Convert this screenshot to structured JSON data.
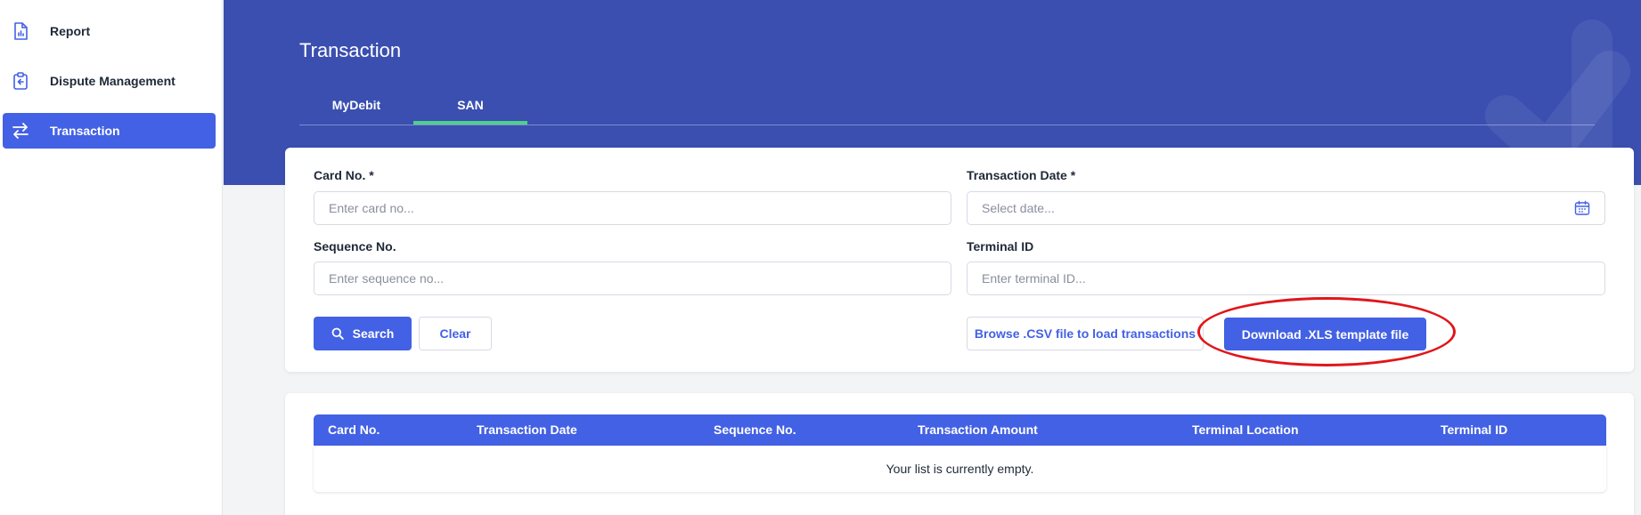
{
  "sidebar": {
    "items": [
      {
        "label": "Report",
        "icon": "report-icon"
      },
      {
        "label": "Dispute Management",
        "icon": "clipboard-icon"
      },
      {
        "label": "Transaction",
        "icon": "swap-arrows-icon",
        "active": true
      }
    ]
  },
  "header": {
    "title": "Transaction",
    "tabs": [
      {
        "label": "MyDebit",
        "active": false
      },
      {
        "label": "SAN",
        "active": true
      }
    ]
  },
  "form": {
    "card_no": {
      "label": "Card No. *",
      "placeholder": "Enter card no...",
      "value": ""
    },
    "transaction_date": {
      "label": "Transaction Date *",
      "placeholder": "Select date...",
      "value": "",
      "icon": "calendar-icon"
    },
    "sequence_no": {
      "label": "Sequence No.",
      "placeholder": "Enter sequence no...",
      "value": ""
    },
    "terminal_id": {
      "label": "Terminal ID",
      "placeholder": "Enter terminal ID...",
      "value": ""
    },
    "buttons": {
      "search": "Search",
      "clear": "Clear",
      "browse_csv": "Browse .CSV file to load transactions",
      "download_xls": "Download .XLS template file"
    }
  },
  "table": {
    "columns": [
      "Card No.",
      "Transaction Date",
      "Sequence No.",
      "Transaction Amount",
      "Terminal Location",
      "Terminal ID"
    ],
    "rows": [],
    "empty_message": "Your list is currently empty."
  },
  "colors": {
    "primary": "#4361e4",
    "banner": "#3a4fb0",
    "tab_active": "#4fd08b",
    "annotation_ring": "#e0161b"
  }
}
